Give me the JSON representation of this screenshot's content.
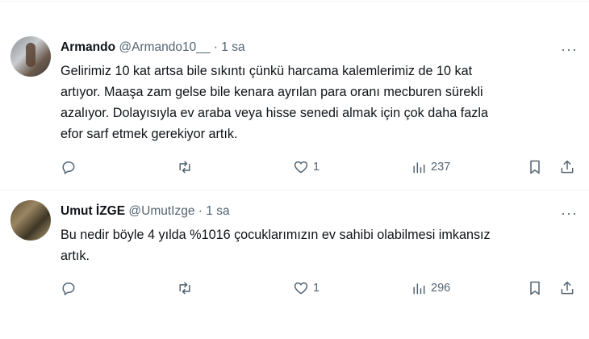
{
  "tweets": [
    {
      "name": "Armando",
      "handle": "@Armando10__",
      "dot": "·",
      "time": "1 sa",
      "more": "···",
      "lines": [
        "Gelirimiz 10 kat artsa bile sıkıntı çünkü harcama kalemlerimiz de 10 kat",
        "artıyor. Maaşa zam gelse bile kenara ayrılan para oranı mecburen sürekli",
        "azalıyor. Dolayısıyla ev araba veya hisse senedi almak için çok daha fazla",
        "efor sarf etmek gerekiyor artık."
      ],
      "likes": "1",
      "views": "237"
    },
    {
      "name": "Umut İZGE",
      "handle": "@UmutIzge",
      "dot": "·",
      "time": "1 sa",
      "more": "···",
      "lines": [
        "Bu nedir böyle 4 yılda %1016 çocuklarımızın ev sahibi olabilmesi imkansız",
        "artık."
      ],
      "likes": "1",
      "views": "296"
    }
  ],
  "icons": {
    "reply": "reply-icon",
    "retweet": "retweet-icon",
    "like": "heart-icon",
    "views": "views-chart-icon",
    "bookmark": "bookmark-icon",
    "share": "share-icon"
  },
  "colors": {
    "text": "#0f1419",
    "secondary": "#536471",
    "divider": "#eff3f4"
  }
}
